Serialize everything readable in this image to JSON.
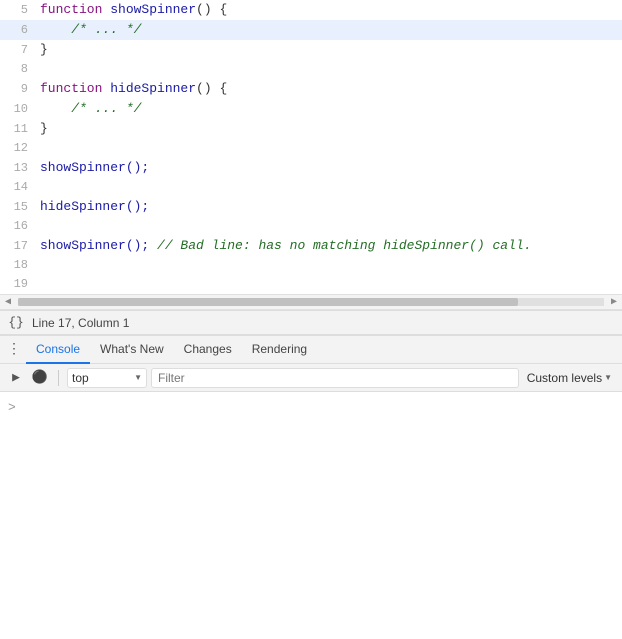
{
  "editor": {
    "lines": [
      {
        "num": 5,
        "tokens": [
          {
            "text": "function ",
            "cls": "kw"
          },
          {
            "text": "showSpinner",
            "cls": "fn-name"
          },
          {
            "text": "() {",
            "cls": "paren"
          }
        ],
        "cursor": false
      },
      {
        "num": 6,
        "tokens": [
          {
            "text": "    /* ... */",
            "cls": "comment"
          }
        ],
        "cursor": true
      },
      {
        "num": 7,
        "tokens": [
          {
            "text": "}",
            "cls": "paren"
          }
        ],
        "cursor": false
      },
      {
        "num": 8,
        "tokens": [],
        "cursor": false
      },
      {
        "num": 9,
        "tokens": [
          {
            "text": "function ",
            "cls": "kw"
          },
          {
            "text": "hideSpinner",
            "cls": "fn-name"
          },
          {
            "text": "() {",
            "cls": "paren"
          }
        ],
        "cursor": false
      },
      {
        "num": 10,
        "tokens": [
          {
            "text": "    /* ... */",
            "cls": "comment"
          }
        ],
        "cursor": false
      },
      {
        "num": 11,
        "tokens": [
          {
            "text": "}",
            "cls": "paren"
          }
        ],
        "cursor": false
      },
      {
        "num": 12,
        "tokens": [],
        "cursor": false
      },
      {
        "num": 13,
        "tokens": [
          {
            "text": "showSpinner();",
            "cls": "fn-call"
          }
        ],
        "cursor": false
      },
      {
        "num": 14,
        "tokens": [],
        "cursor": false
      },
      {
        "num": 15,
        "tokens": [
          {
            "text": "hideSpinner();",
            "cls": "fn-call"
          }
        ],
        "cursor": false
      },
      {
        "num": 16,
        "tokens": [],
        "cursor": false
      },
      {
        "num": 17,
        "tokens": [
          {
            "text": "showSpinner(); ",
            "cls": "fn-call"
          },
          {
            "text": "// Bad line: has no matching hideSpinner() call.",
            "cls": "bad-comment"
          }
        ],
        "cursor": false
      },
      {
        "num": 18,
        "tokens": [],
        "cursor": false
      },
      {
        "num": 19,
        "tokens": [],
        "cursor": false
      }
    ]
  },
  "status_bar": {
    "icon": "{}",
    "text": "Line 17, Column 1"
  },
  "console_panel": {
    "tabs": [
      {
        "label": "Console",
        "active": true
      },
      {
        "label": "What's New",
        "active": false
      },
      {
        "label": "Changes",
        "active": false
      },
      {
        "label": "Rendering",
        "active": false
      }
    ],
    "controls": {
      "context_label": "top",
      "filter_placeholder": "Filter",
      "custom_levels_label": "Custom levels"
    }
  },
  "console_content": {
    "prompt_arrow": ">"
  }
}
